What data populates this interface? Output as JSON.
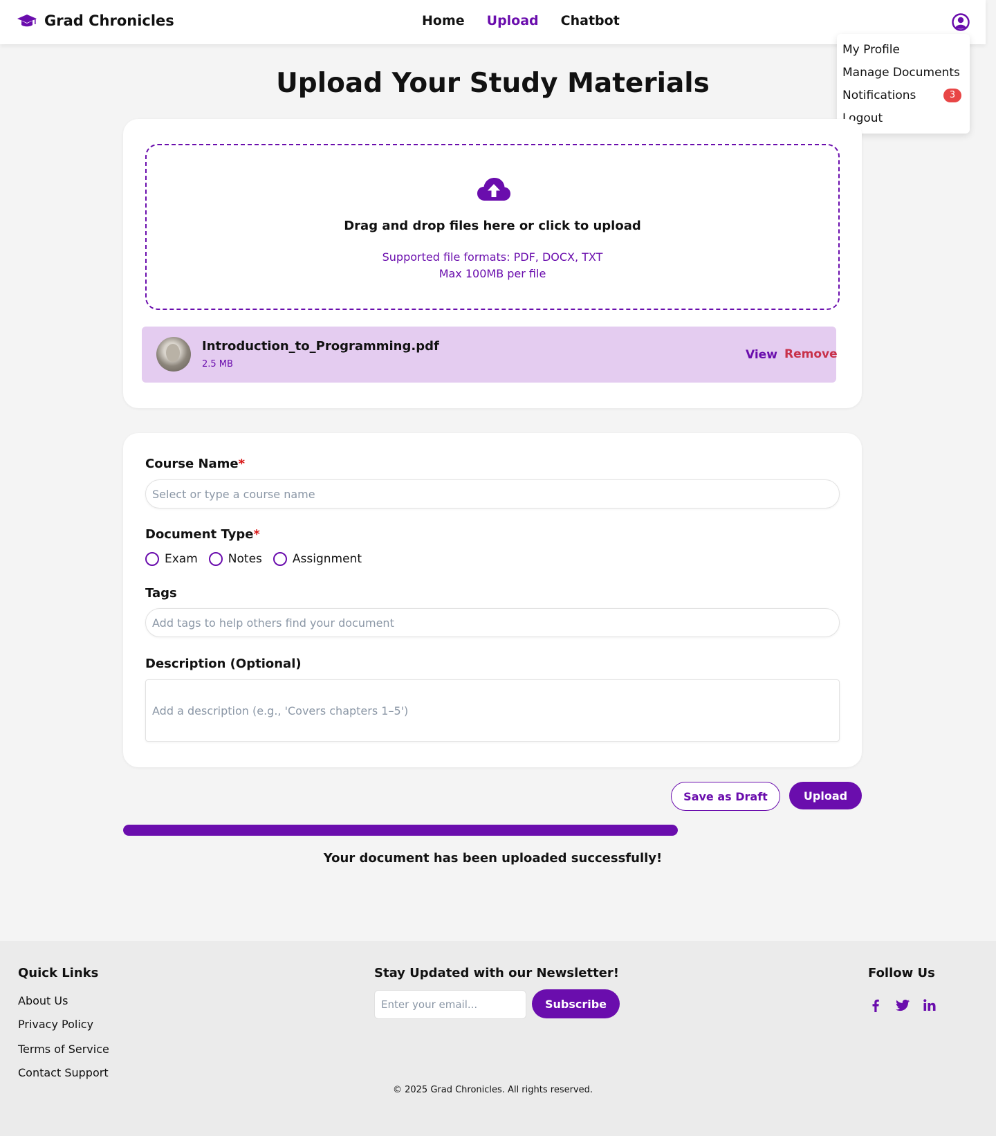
{
  "brand": {
    "name": "Grad Chronicles",
    "icon": "graduation-cap-icon",
    "color": "#6a0dad"
  },
  "nav": {
    "home": "Home",
    "upload": "Upload",
    "chatbot": "Chatbot",
    "active": "Upload"
  },
  "user_menu": {
    "icon": "user-circle-icon",
    "items": {
      "profile": "My Profile",
      "documents": "Manage Documents",
      "notifications": "Notifications",
      "notifications_count": "3",
      "logout": "Logout"
    }
  },
  "page_title": "Upload Your Study Materials",
  "dropzone": {
    "icon": "cloud-upload-icon",
    "title": "Drag and drop files here or click to upload",
    "formats": "Supported file formats: PDF, DOCX, TXT",
    "max_size": "Max 100MB per file"
  },
  "file": {
    "name": "Introduction_to_Programming.pdf",
    "size": "2.5 MB",
    "view": "View",
    "remove": "Remove"
  },
  "form": {
    "course_label": "Course Name",
    "course_placeholder": "Select or type a course name",
    "doctype_label": "Document Type",
    "required_mark": "*",
    "doctypes": {
      "exam": "Exam",
      "notes": "Notes",
      "assignment": "Assignment"
    },
    "tags_label": "Tags",
    "tags_placeholder": "Add tags to help others find your document",
    "description_label": "Description (Optional)",
    "description_placeholder": "Add a description (e.g., 'Covers chapters 1–5')"
  },
  "actions": {
    "draft": "Save as Draft",
    "upload": "Upload"
  },
  "progress": {
    "percent": 100
  },
  "success_message": "Your document has been uploaded successfully!",
  "footer": {
    "quick_links_title": "Quick Links",
    "links": {
      "about": "About Us",
      "privacy": "Privacy Policy",
      "terms": "Terms of Service",
      "support": "Contact Support"
    },
    "newsletter_title": "Stay Updated with our Newsletter!",
    "email_placeholder": "Enter your email...",
    "subscribe": "Subscribe",
    "follow_title": "Follow Us",
    "social_icons": [
      "facebook-icon",
      "twitter-icon",
      "linkedin-icon"
    ],
    "copyright": "© 2025 Grad Chronicles. All rights reserved."
  }
}
